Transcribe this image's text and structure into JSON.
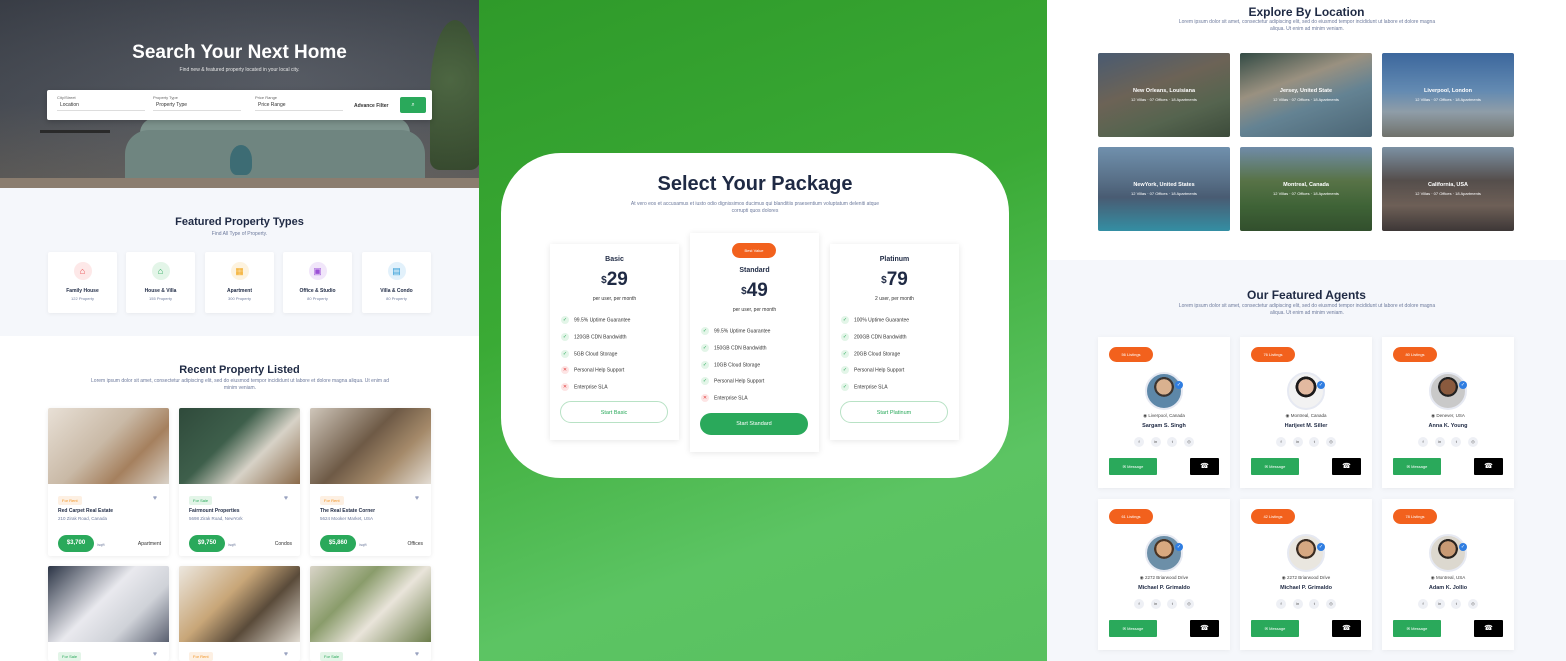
{
  "hero": {
    "title": "Search Your Next Home",
    "subtitle": "Find new & featured property located in your local city.",
    "fields": [
      {
        "label": "City/Street",
        "value": "Location"
      },
      {
        "label": "Property Type",
        "value": "Property Type"
      },
      {
        "label": "Price Range",
        "value": "Price Range"
      }
    ],
    "advance_filter": "Advance Filter",
    "search_icon": "search-icon"
  },
  "types": {
    "title": "Featured Property Types",
    "subtitle": "Find All Type of Property.",
    "items": [
      {
        "name": "Family House",
        "count": "122 Property",
        "icon": "house-icon",
        "color": "#e8494b",
        "bg": "#fde8e8"
      },
      {
        "name": "House & Villa",
        "count": "155 Property",
        "icon": "villa-icon",
        "color": "#2aa95b",
        "bg": "#e3f5e8"
      },
      {
        "name": "Apartment",
        "count": "300 Property",
        "icon": "building-icon",
        "color": "#f2a71d",
        "bg": "#fdf3df"
      },
      {
        "name": "Office & Studio",
        "count": "80 Property",
        "icon": "office-icon",
        "color": "#9b4fd6",
        "bg": "#f1e6fa"
      },
      {
        "name": "Villa & Condo",
        "count": "80 Property",
        "icon": "condo-icon",
        "color": "#2f9bd6",
        "bg": "#e2f1fb"
      }
    ]
  },
  "recent": {
    "title": "Recent Property Listed",
    "subtitle": "Lorem ipsum dolor sit amet, consectetur adipiscing elit, sed do eiusmod tempor incididunt ut labore et dolore magna aliqua. Ut enim ad minim veniam.",
    "cards": [
      {
        "badge": "For Rent",
        "name": "Red Carpet Real Estate",
        "address": "210 Zirak Road, Canada",
        "price": "$3,700",
        "unit": "/sqft",
        "kind": "Apartment"
      },
      {
        "badge": "For Sale",
        "name": "Fairmount Properties",
        "address": "5698 Zirak Road, NewYork",
        "price": "$9,750",
        "unit": "/sqft",
        "kind": "Condos"
      },
      {
        "badge": "For Rent",
        "name": "The Real Estate Corner",
        "address": "5624 Mooker Market, USA",
        "price": "$5,860",
        "unit": "/sqft",
        "kind": "Offices"
      },
      {
        "badge": "For Sale"
      },
      {
        "badge": "For Rent"
      },
      {
        "badge": "For Sale"
      }
    ]
  },
  "package": {
    "title": "Select Your Package",
    "subtitle": "At vero eos et accusamus et iusto odio dignissimos ducimus qui blanditiis praesentium voluptatum deleniti atque corrupti quos dolores",
    "plans": [
      {
        "name": "Basic",
        "currency": "$",
        "price": "29",
        "per": "per user, per month",
        "cta": "Start Basic",
        "features": [
          {
            "text": "99.5% Uptime Guarantee",
            "ok": true
          },
          {
            "text": "120GB CDN Bandwidth",
            "ok": true
          },
          {
            "text": "5GB Cloud Storage",
            "ok": true
          },
          {
            "text": "Personal Help Support",
            "ok": false
          },
          {
            "text": "Enterprise SLA",
            "ok": false
          }
        ]
      },
      {
        "name": "Standard",
        "badge": "Best Value",
        "currency": "$",
        "price": "49",
        "per": "per user, per month",
        "cta": "Start Standard",
        "features": [
          {
            "text": "99.5% Uptime Guarantee",
            "ok": true
          },
          {
            "text": "150GB CDN Bandwidth",
            "ok": true
          },
          {
            "text": "10GB Cloud Storage",
            "ok": true
          },
          {
            "text": "Personal Help Support",
            "ok": true
          },
          {
            "text": "Enterprise SLA",
            "ok": false
          }
        ]
      },
      {
        "name": "Platinum",
        "currency": "$",
        "price": "79",
        "per": "2 user, per month",
        "cta": "Start Platinum",
        "features": [
          {
            "text": "100% Uptime Guarantee",
            "ok": true
          },
          {
            "text": "200GB CDN Bandwidth",
            "ok": true
          },
          {
            "text": "20GB Cloud Storage",
            "ok": true
          },
          {
            "text": "Personal Help Support",
            "ok": true
          },
          {
            "text": "Enterprise SLA",
            "ok": true
          }
        ]
      }
    ]
  },
  "locations": {
    "title": "Explore By Location",
    "subtitle": "Lorem ipsum dolor sit amet, consectetur adipiscing elit, sed do eiusmod tempor incididunt ut labore et dolore magna aliqua. Ut enim ad minim veniam.",
    "items": [
      {
        "name": "New Orleans, Louisiana",
        "stats": "12 Villas · 07 Offices · 18 Apartments"
      },
      {
        "name": "Jersey, United State",
        "stats": "12 Villas · 07 Offices · 18 Apartments"
      },
      {
        "name": "Liverpool, London",
        "stats": "12 Villas · 07 Offices · 18 Apartments"
      },
      {
        "name": "NewYork, United States",
        "stats": "12 Villas · 07 Offices · 18 Apartments"
      },
      {
        "name": "Montreal, Canada",
        "stats": "12 Villas · 07 Offices · 18 Apartments"
      },
      {
        "name": "California, USA",
        "stats": "12 Villas · 07 Offices · 18 Apartments"
      }
    ]
  },
  "agents": {
    "title": "Our Featured Agents",
    "subtitle": "Lorem ipsum dolor sit amet, consectetur adipiscing elit, sed do eiusmod tempor incididunt ut labore et dolore magna aliqua. Ut enim ad minim veniam.",
    "message_label": "Message",
    "items": [
      {
        "listings": "56 Listings",
        "location": "Liverpool, Canada",
        "name": "Sargam S. Singh"
      },
      {
        "listings": "76 Listings",
        "location": "Montreal, Canada",
        "name": "Harijeet M. Siller"
      },
      {
        "listings": "80 Listings",
        "location": "Denever, USA",
        "name": "Anna K. Young"
      },
      {
        "listings": "61 Listings",
        "location": "2272 Briarwood Drive",
        "name": "Michael P. Grimaldo"
      },
      {
        "listings": "42 Listings",
        "location": "2272 Briarwood Drive",
        "name": "Michael P. Grimaldo"
      },
      {
        "listings": "78 Listings",
        "location": "Montreal, USA",
        "name": "Adam K. Jollio"
      }
    ]
  },
  "colors": {
    "accent": "#2aa95b",
    "orange": "#f2611d",
    "navy": "#1f2a44"
  }
}
